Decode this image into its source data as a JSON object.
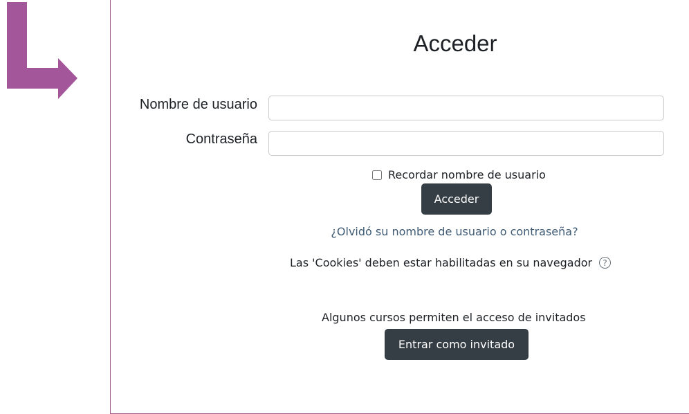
{
  "login": {
    "title": "Acceder",
    "username_label": "Nombre de usuario",
    "username_value": "",
    "password_label": "Contraseña",
    "password_value": "",
    "remember_label": "Recordar nombre de usuario",
    "remember_checked": false,
    "submit_label": "Acceder",
    "forgot_link": "¿Olvidó su nombre de usuario o contraseña?",
    "cookies_notice": "Las 'Cookies' deben estar habilitadas en su navegador"
  },
  "guest": {
    "note": "Algunos cursos permiten el acceso de invitados",
    "button_label": "Entrar como invitado"
  },
  "icons": {
    "help": "help-circle-icon",
    "arrow": "arrow-right-icon"
  },
  "colors": {
    "arrow": "#a4569a",
    "panel_border": "#a05a8e",
    "button_bg": "#363e45",
    "link": "#3f5b74"
  }
}
